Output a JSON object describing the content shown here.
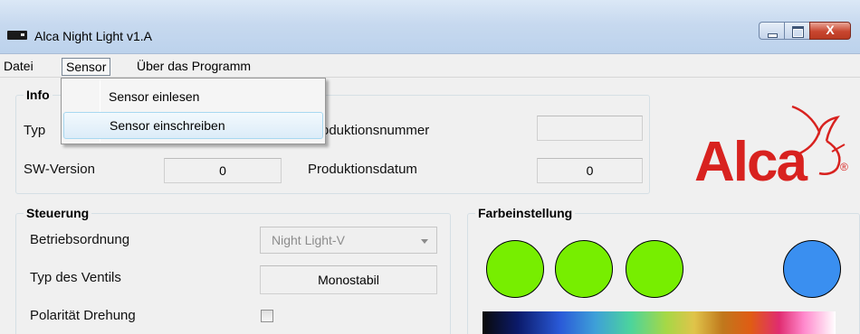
{
  "window": {
    "title": "Alca Night Light  v1.A",
    "close_label": "X"
  },
  "menubar": {
    "items": [
      "Datei",
      "Sensor",
      "Über das Programm"
    ]
  },
  "dropdown": {
    "items": [
      "Sensor einlesen",
      "Sensor einschreiben"
    ]
  },
  "info": {
    "title": "Info",
    "typ_label": "Typ",
    "sw_label": "SW-Version",
    "sw_value": "0",
    "prod_nr_label": "Produktionsnummer",
    "prod_nr_value": "",
    "prod_datum_label": "Produktionsdatum",
    "prod_datum_value": "0"
  },
  "steuerung": {
    "title": "Steuerung",
    "betrieb_label": "Betriebsordnung",
    "betrieb_value": "Night Light-V",
    "ventil_label": "Typ des Ventils",
    "ventil_value": "Monostabil",
    "polaritaet_label": "Polarität Drehung",
    "polaritaet_checked": false
  },
  "farbe": {
    "title": "Farbeinstellung",
    "colors": [
      "#77ee00",
      "#77ee00",
      "#77ee00",
      "#3a8ff0"
    ]
  },
  "logo": {
    "text": "Alca",
    "reg": "®",
    "color": "#d8221f"
  }
}
